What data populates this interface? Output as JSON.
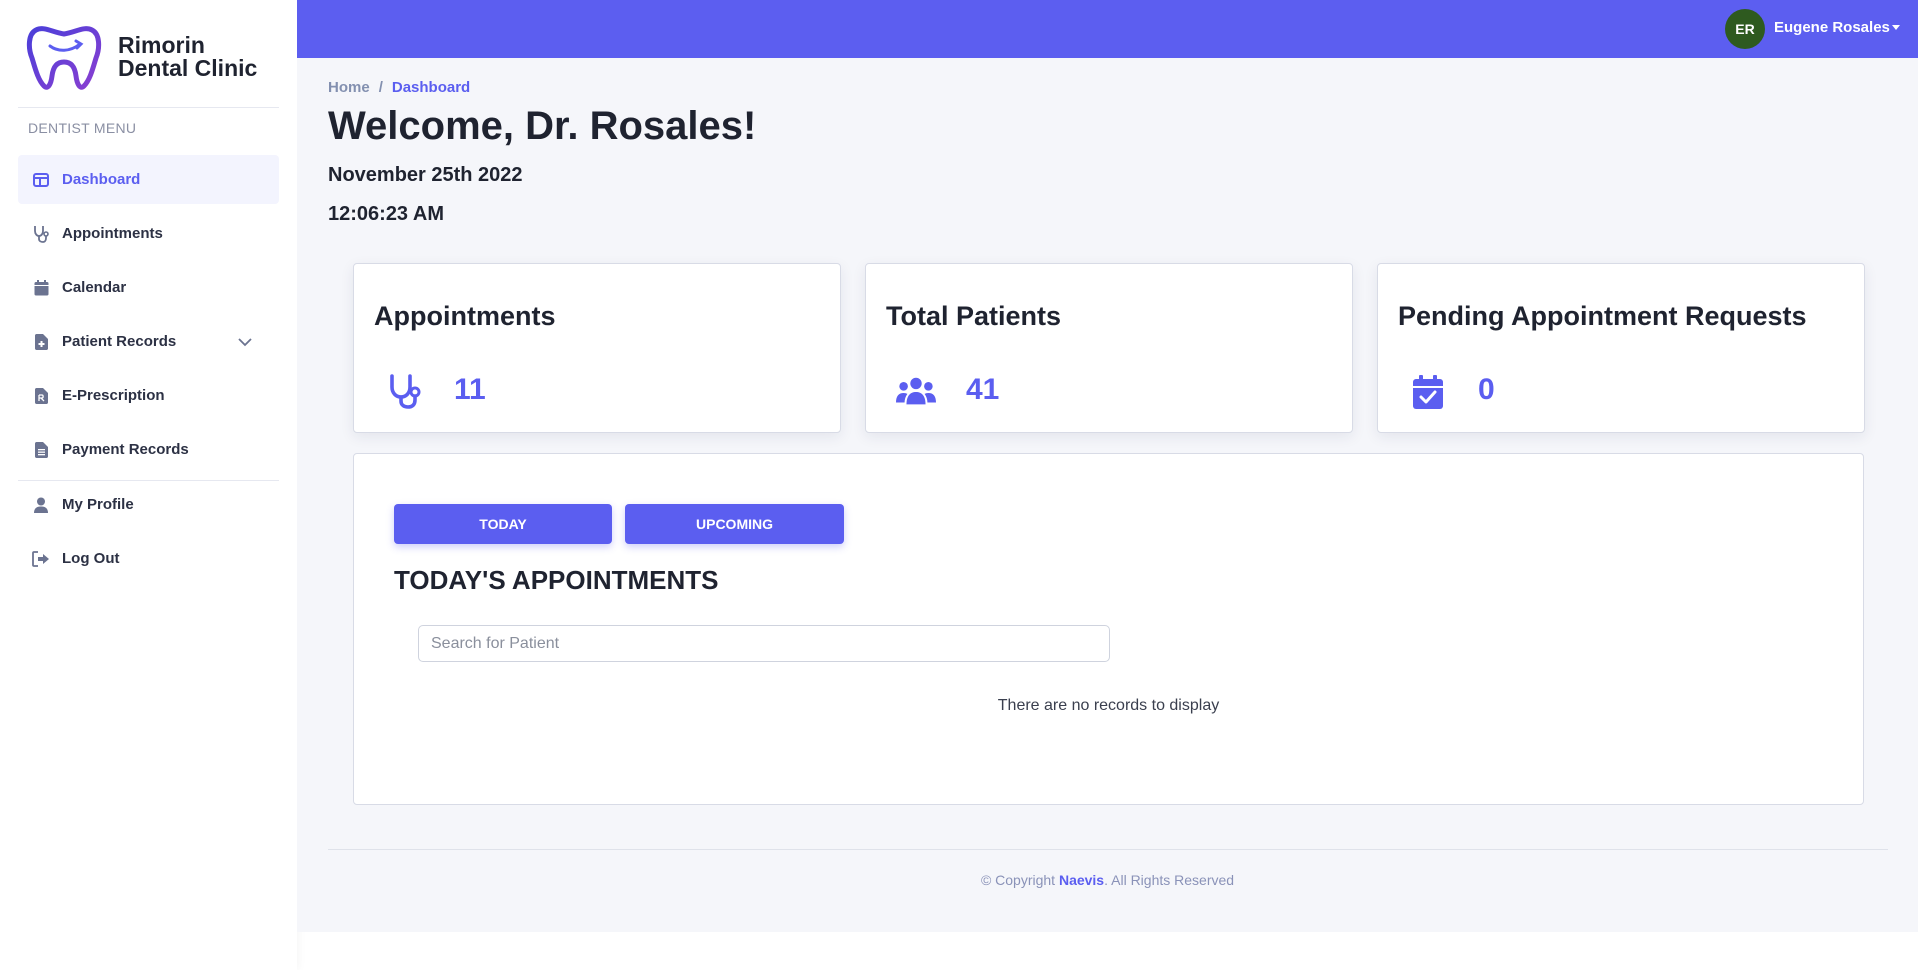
{
  "brand": {
    "name_line1": "Rimorin",
    "name_line2": "Dental Clinic"
  },
  "sidebar": {
    "heading": "DENTIST MENU",
    "items": [
      {
        "label": "Dashboard",
        "icon": "layout-icon",
        "active": true
      },
      {
        "label": "Appointments",
        "icon": "stethoscope-icon"
      },
      {
        "label": "Calendar",
        "icon": "calendar-icon"
      },
      {
        "label": "Patient Records",
        "icon": "file-medical-icon",
        "has_submenu": true
      },
      {
        "label": "E-Prescription",
        "icon": "file-prescription-icon"
      },
      {
        "label": "Payment Records",
        "icon": "file-invoice-icon"
      },
      {
        "label": "My Profile",
        "icon": "user-icon"
      },
      {
        "label": "Log Out",
        "icon": "sign-out-icon"
      }
    ]
  },
  "topbar": {
    "avatar_initials": "ER",
    "user_name": "Eugene Rosales",
    "avatar_color": "#2e5a1f"
  },
  "breadcrumb": {
    "home": "Home",
    "separator": "/",
    "current": "Dashboard"
  },
  "header": {
    "welcome": "Welcome, Dr. Rosales!",
    "date": "November 25th 2022",
    "time": "12:06:23 AM"
  },
  "cards": [
    {
      "title": "Appointments",
      "value": "11",
      "icon": "stethoscope-icon"
    },
    {
      "title": "Total Patients",
      "value": "41",
      "icon": "users-icon"
    },
    {
      "title": "Pending Appointment Requests",
      "value": "0",
      "icon": "calendar-check-icon"
    }
  ],
  "appointments_panel": {
    "tab_today": "TODAY",
    "tab_upcoming": "UPCOMING",
    "title": "TODAY'S APPOINTMENTS",
    "search_placeholder": "Search for Patient",
    "empty_message": "There are no records to display"
  },
  "footer": {
    "prefix": "© Copyright",
    "brand": "Naevis",
    "suffix": ". All Rights Reserved"
  },
  "colors": {
    "accent": "#5c5ef0",
    "background": "#f5f6fa"
  }
}
